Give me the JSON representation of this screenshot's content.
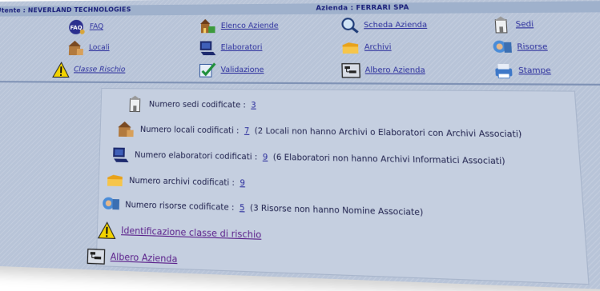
{
  "header": {
    "user": "Utente : NEVERLAND TECHNOLOGIES",
    "company": "Azienda : FERRARI SPA"
  },
  "nav": [
    {
      "label": "FAQ",
      "icon": "faq-icon"
    },
    {
      "label": "Elenco Aziende",
      "icon": "companies-icon"
    },
    {
      "label": "Scheda Azienda",
      "icon": "magnifier-icon"
    },
    {
      "label": "Sedi",
      "icon": "building-icon"
    },
    {
      "label": "Locali",
      "icon": "room-icon"
    },
    {
      "label": "Elaboratori",
      "icon": "computer-icon"
    },
    {
      "label": "Archivi",
      "icon": "folder-icon"
    },
    {
      "label": "Risorse",
      "icon": "people-icon"
    },
    {
      "label": "Classe Rischio",
      "icon": "warning-icon"
    },
    {
      "label": "Validazione",
      "icon": "check-icon"
    },
    {
      "label": "Albero Azienda",
      "icon": "tree-icon"
    },
    {
      "label": "Stampe",
      "icon": "printer-icon"
    }
  ],
  "summary": {
    "sedi": {
      "label": "Numero sedi codificate :",
      "count": "3",
      "note": ""
    },
    "locali": {
      "label": "Numero locali codificati :",
      "count": "7",
      "note": "(2 Locali non hanno Archivi o Elaboratori con Archivi Associati)"
    },
    "elaboratori": {
      "label": "Numero elaboratori codificati :",
      "count": "9",
      "note": "(6 Elaboratori non hanno Archivi Informatici Associati)"
    },
    "archivi": {
      "label": "Numero archivi codificati :",
      "count": "9",
      "note": ""
    },
    "risorse": {
      "label": "Numero risorse codificate :",
      "count": "5",
      "note": "(3 Risorse non hanno Nomine Associate)"
    }
  },
  "links": {
    "classe_rischio": "Identificazione classe di rischio",
    "albero": "Albero Azienda"
  }
}
